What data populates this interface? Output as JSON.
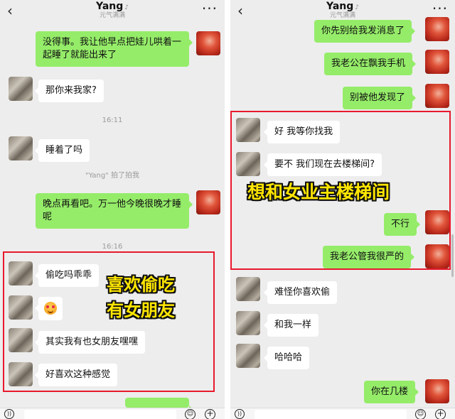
{
  "chat": {
    "title": "Yang",
    "subtitle": "元气满满",
    "back_icon": "chevron-left-icon",
    "more_icon": "more-icon",
    "mute_icon": "bell-off-icon"
  },
  "left": {
    "messages": [
      {
        "side": "out",
        "text": "没得事。我让他早点把娃儿哄着一起睡了就能出来了"
      },
      {
        "side": "in",
        "text": "那你来我家?"
      },
      {
        "side": "in",
        "text": "睡着了吗"
      },
      {
        "side": "out",
        "text": "晚点再看吧。万一他今晚很晚才睡呢"
      },
      {
        "side": "in",
        "text": "偷吃吗乖乖"
      },
      {
        "side": "in",
        "text": "",
        "emoji": "heart-eyes-emoji"
      },
      {
        "side": "in",
        "text": "其实我有也女朋友嘿嘿"
      },
      {
        "side": "in",
        "text": "好喜欢这种感觉"
      }
    ],
    "timestamps": [
      "16:11",
      "16:16"
    ],
    "system_message": "\"Yang\" 拍了拍我",
    "overlay_line1": "喜欢偷吃",
    "overlay_line2": "有女朋友"
  },
  "right": {
    "messages": [
      {
        "side": "out",
        "text": "你先别给我发消息了"
      },
      {
        "side": "out",
        "text": "我老公在飘我手机"
      },
      {
        "side": "out",
        "text": "别被他发现了"
      },
      {
        "side": "in",
        "text": "好 我等你找我"
      },
      {
        "side": "in",
        "text": "要不 我们现在去楼梯间?"
      },
      {
        "side": "out",
        "text": "不行"
      },
      {
        "side": "out",
        "text": "我老公管我很严的"
      },
      {
        "side": "in",
        "text": "难怪你喜欢偷"
      },
      {
        "side": "in",
        "text": "和我一样"
      },
      {
        "side": "in",
        "text": "哈哈哈"
      },
      {
        "side": "out",
        "text": "你在几楼"
      }
    ],
    "overlay_text": "想和女业主楼梯间"
  },
  "colors": {
    "outgoing_bubble": "#95ec69",
    "incoming_bubble": "#ffffff",
    "background": "#ededed",
    "highlight_box": "#e8192c",
    "overlay_text": "#ffe600"
  },
  "input_bar": {
    "voice_icon": "voice-icon",
    "emoji_icon": "emoji-icon",
    "plus_icon": "plus-icon"
  }
}
